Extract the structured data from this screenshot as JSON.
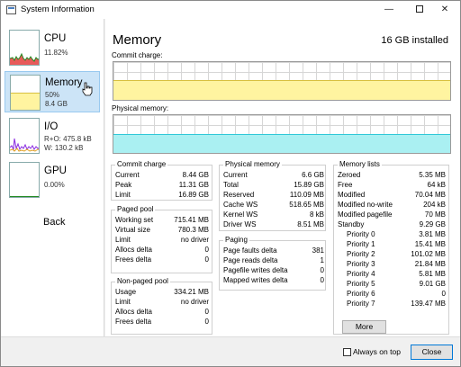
{
  "window": {
    "title": "System Information",
    "app_icon": "monitor-icon"
  },
  "titlebar_buttons": {
    "minimize": "—",
    "close": "✕"
  },
  "sidebar": {
    "items": [
      {
        "name": "CPU",
        "line1": "11.82%",
        "line2": ""
      },
      {
        "name": "Memory",
        "line1": "50%",
        "line2": "8.4 GB",
        "selected": true
      },
      {
        "name": "I/O",
        "line1": "R+O: 475.8 kB",
        "line2": "W: 130.2 kB"
      },
      {
        "name": "GPU",
        "line1": "0.00%",
        "line2": ""
      }
    ],
    "back_label": "Back"
  },
  "main": {
    "title": "Memory",
    "installed": "16 GB installed",
    "commit_label": "Commit charge:",
    "physical_label": "Physical memory:",
    "commit_fill_fraction": 0.53,
    "physical_fill_fraction": 0.5
  },
  "commit_charge": {
    "title": "Commit charge",
    "rows": [
      {
        "k": "Current",
        "v": "8.44 GB"
      },
      {
        "k": "Peak",
        "v": "11.31 GB"
      },
      {
        "k": "Limit",
        "v": "16.89 GB"
      }
    ]
  },
  "paged_pool": {
    "title": "Paged pool",
    "rows": [
      {
        "k": "Working set",
        "v": "715.41 MB"
      },
      {
        "k": "Virtual size",
        "v": "780.3 MB"
      },
      {
        "k": "Limit",
        "v": "no driver"
      },
      {
        "k": "Allocs delta",
        "v": "0"
      },
      {
        "k": "Frees delta",
        "v": "0"
      }
    ]
  },
  "non_paged_pool": {
    "title": "Non-paged pool",
    "rows": [
      {
        "k": "Usage",
        "v": "334.21 MB"
      },
      {
        "k": "Limit",
        "v": "no driver"
      },
      {
        "k": "Allocs delta",
        "v": "0"
      },
      {
        "k": "Frees delta",
        "v": "0"
      }
    ]
  },
  "physical_memory": {
    "title": "Physical memory",
    "rows": [
      {
        "k": "Current",
        "v": "6.6 GB"
      },
      {
        "k": "Total",
        "v": "15.89 GB"
      },
      {
        "k": "Reserved",
        "v": "110.09 MB"
      },
      {
        "k": "Cache WS",
        "v": "518.65 MB"
      },
      {
        "k": "Kernel WS",
        "v": "8 kB"
      },
      {
        "k": "Driver WS",
        "v": "8.51 MB"
      }
    ]
  },
  "paging": {
    "title": "Paging",
    "rows": [
      {
        "k": "Page faults delta",
        "v": "381"
      },
      {
        "k": "Page reads delta",
        "v": "1"
      },
      {
        "k": "Pagefile writes delta",
        "v": "0"
      },
      {
        "k": "Mapped writes delta",
        "v": "0"
      }
    ]
  },
  "memory_lists": {
    "title": "Memory lists",
    "rows": [
      {
        "k": "Zeroed",
        "v": "5.35 MB"
      },
      {
        "k": "Free",
        "v": "64 kB"
      },
      {
        "k": "Modified",
        "v": "70.04 MB"
      },
      {
        "k": "Modified no-write",
        "v": "204 kB"
      },
      {
        "k": "Modified pagefile",
        "v": "70 MB"
      },
      {
        "k": "Standby",
        "v": "9.29 GB"
      },
      {
        "k": "Priority 0",
        "v": "3.81 MB"
      },
      {
        "k": "Priority 1",
        "v": "15.41 MB"
      },
      {
        "k": "Priority 2",
        "v": "101.02 MB"
      },
      {
        "k": "Priority 3",
        "v": "21.84 MB"
      },
      {
        "k": "Priority 4",
        "v": "5.81 MB"
      },
      {
        "k": "Priority 5",
        "v": "9.01 GB"
      },
      {
        "k": "Priority 6",
        "v": "0"
      },
      {
        "k": "Priority 7",
        "v": "139.47 MB"
      }
    ],
    "more_label": "More"
  },
  "bottom": {
    "always_on_top": "Always on top",
    "close": "Close"
  }
}
